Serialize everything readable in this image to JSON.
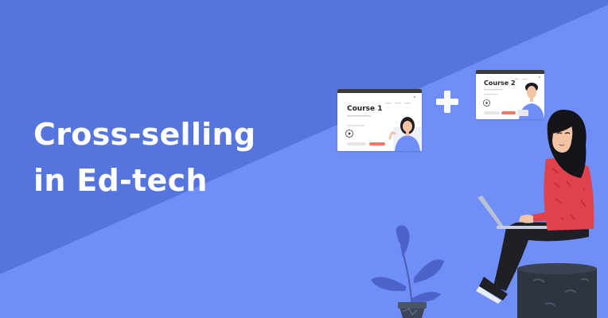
{
  "headline": {
    "line1": "Cross-selling",
    "line2": "in Ed-tech"
  },
  "cards": [
    {
      "title": "Course 1"
    },
    {
      "title": "Course 2"
    }
  ],
  "icons": {
    "plus": "plus-icon",
    "play": "play-icon"
  },
  "colors": {
    "background_top": "#5872e0",
    "background_bottom": "#6f8ef7",
    "text": "#ffffff",
    "accent_button": "#f07a6a",
    "sweater": "#e0414c",
    "pants": "#1f1f26",
    "stool": "#2e3440"
  }
}
